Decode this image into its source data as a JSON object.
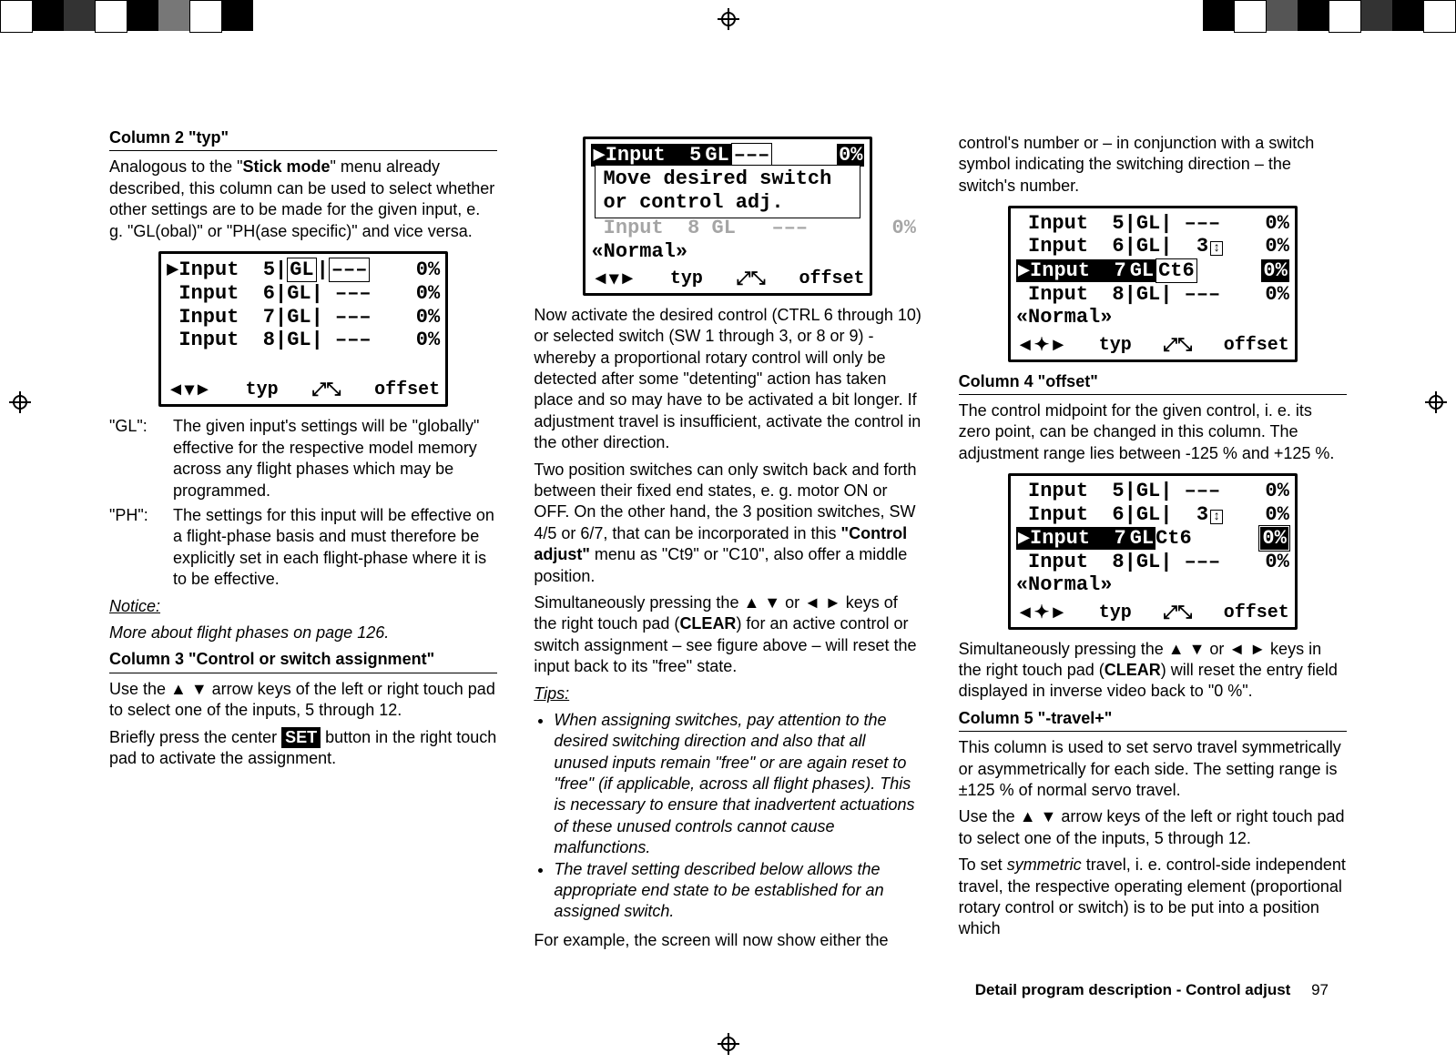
{
  "column1": {
    "h1": "Column 2 \"typ\"",
    "p1a": "Analogous to the \"",
    "p1b": "Stick mode",
    "p1c": "\" menu already described, this column can be used to select whether other settings are to be made for the given input, e. g. \"GL(obal)\" or \"PH(ase specific)\" and vice versa.",
    "gl_term": "\"GL\":",
    "gl_body": "The given input's settings will be \"globally\" effective for the respective model memory across any flight phases which may be programmed.",
    "ph_term": "\"PH\":",
    "ph_body": "The settings for this input will be effective on a flight-phase basis and must therefore be explicitly set in each flight-phase where it is to be effective.",
    "notice": "Notice:",
    "noticebody": "More about flight phases on page 126.",
    "h2": "Column 3 \"Control or switch assignment\"",
    "p2": "Use the ▲ ▼ arrow keys of the left or right touch pad to select one of the inputs, 5 through 12.",
    "p3a": "Briefly press the center ",
    "p3set": "SET",
    "p3b": " button in the right touch pad to activate the assignment."
  },
  "column2": {
    "p1": "Now activate the desired control (CTRL 6 through 10) or selected switch (SW 1 through 3, or 8 or 9) - whereby a proportional rotary control will only be detected after some \"detenting\" action has taken place and so may have to be activated a bit longer. If adjustment travel is insufficient, activate the control in the other direction.",
    "p2a": "Two position switches can only switch back and forth between their fixed end states, e. g. motor ON or OFF. On the other hand, the 3 position switches, SW 4/5 or 6/7, that can be incorporated in this ",
    "p2b": "\"Control adjust\"",
    "p2c": " menu as \"Ct9\" or \"C10\", also offer a middle position.",
    "p3a": "Simultaneously pressing the ▲ ▼ or ◄ ► keys of the right touch pad (",
    "p3b": "CLEAR",
    "p3c": ") for an active control or switch assignment – see figure above – will reset the input back to its \"free\" state.",
    "tips": "Tips:",
    "tip1": "When assigning switches, pay attention to the desired switching direction and also that all unused inputs remain \"free\" or are again reset to \"free\" (if applicable, across all flight phases). This is necessary to ensure that inadvertent actuations of these unused controls cannot cause malfunctions.",
    "tip2": "The travel setting described below allows the appropriate end state to be established for an assigned switch.",
    "p4": "For example, the screen will now show either the"
  },
  "column3": {
    "p1": "control's number or – in conjunction with a switch symbol indicating the switching direction – the switch's number.",
    "h1": "Column 4 \"offset\"",
    "p2": "The control midpoint for the given control, i. e. its zero point, can be changed in this column. The adjustment range lies between -125 % and +125 %.",
    "p3a": "Simultaneously pressing the ▲ ▼ or ◄ ► keys in the right touch pad (",
    "p3b": "CLEAR",
    "p3c": ") will reset the entry field displayed in inverse video back to \"0 %\".",
    "h2": "Column 5 \"-travel+\"",
    "p4": "This column is used to set servo travel symmetrically or asymmetrically for each side. The setting range is ±125 % of normal servo travel.",
    "p5": "Use the ▲ ▼ arrow keys of the left or right touch pad to select one of the inputs, 5 through 12.",
    "p6a": "To set ",
    "p6s": "symmetric",
    "p6b": " travel, i. e. control-side independent travel, the respective operating element (proportional rotary control or switch) is to be put into a position which"
  },
  "lcd1": {
    "r1": "▶Input  5",
    "r1b": "GL",
    "r1c": "–––",
    "r1d": "0%",
    "r2": " Input  6",
    "r2b": "GL",
    "r2c": "–––",
    "r2d": "0%",
    "r3": " Input  7",
    "r3b": "GL",
    "r3c": "–––",
    "r3d": "0%",
    "r4": " Input  8",
    "r4b": "GL",
    "r4c": "–––",
    "r4d": "0%",
    "foot_nav": "◄▾►",
    "foot_typ": "typ",
    "foot_sym": "⤢⤡",
    "foot_off": "offset"
  },
  "lcd2": {
    "top_l": "▶Input  5",
    "top_b": "GL",
    "top_c": "–––",
    "top_d": "0%",
    "msg1": "Move  desired  switch",
    "msg2": " or  control  adj.",
    "ghost": " Input  8 GL   –––       0%",
    "normal": "«Normal»",
    "foot_nav": "◄▾►",
    "foot_typ": "typ",
    "foot_sym": "⤢⤡",
    "foot_off": "offset"
  },
  "lcd3": {
    "r1": " Input  5",
    "r1b": "GL",
    "r1c": "–––",
    "r1d": "0%",
    "r2": " Input  6",
    "r2b": "GL",
    "r2c": " 3",
    "r2d": "0%",
    "r3": "▶Input  7",
    "r3b": "GL",
    "r3c": "Ct6",
    "r3d": "0%",
    "r4": " Input  8",
    "r4b": "GL",
    "r4c": "–––",
    "r4d": "0%",
    "normal": "«Normal»",
    "foot_nav": "◄✦►",
    "foot_typ": "typ",
    "foot_sym": "⤢⤡",
    "foot_off": "offset"
  },
  "lcd4": {
    "r1": " Input  5",
    "r1b": "GL",
    "r1c": "–––",
    "r1d": "0%",
    "r2": " Input  6",
    "r2b": "GL",
    "r2c": " 3",
    "r2d": "0%",
    "r3": "▶Input  7",
    "r3b": "GL",
    "r3c": "Ct6",
    "r3d": "0%",
    "r4": " Input  8",
    "r4b": "GL",
    "r4c": "–––",
    "r4d": "0%",
    "normal": "«Normal»",
    "foot_nav": "◄✦►",
    "foot_typ": "typ",
    "foot_sym": "⤢⤡",
    "foot_off": "offset"
  },
  "footer": {
    "text": "Detail program description - Control adjust",
    "page": "97"
  }
}
